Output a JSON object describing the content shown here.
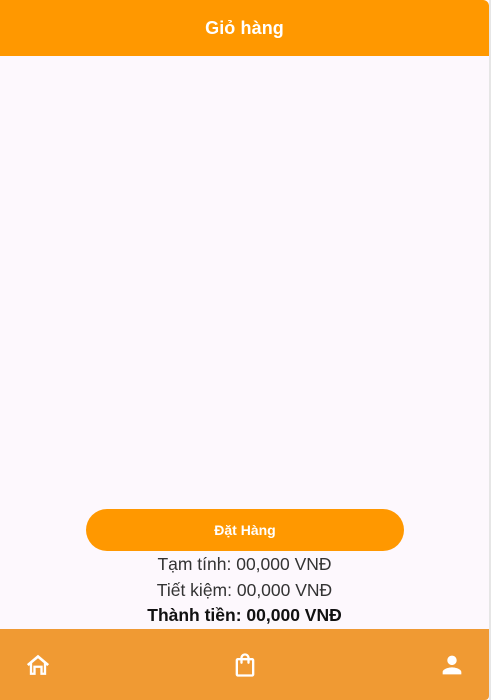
{
  "header": {
    "title": "Giỏ hàng"
  },
  "actions": {
    "order_button_label": "Đặt Hàng"
  },
  "summary": {
    "subtotal": "Tạm tính: 00,000 VNĐ",
    "savings": "Tiết kiệm: 00,000 VNĐ",
    "total": "Thành tiền: 00,000 VNĐ"
  },
  "bottom_nav": {
    "items": [
      {
        "icon": "home-icon"
      },
      {
        "icon": "shopping-bag-icon"
      },
      {
        "icon": "person-icon"
      }
    ]
  },
  "colors": {
    "accent": "#ff9800",
    "bottom_bar": "#f09a33",
    "background": "#fdf8fd"
  }
}
